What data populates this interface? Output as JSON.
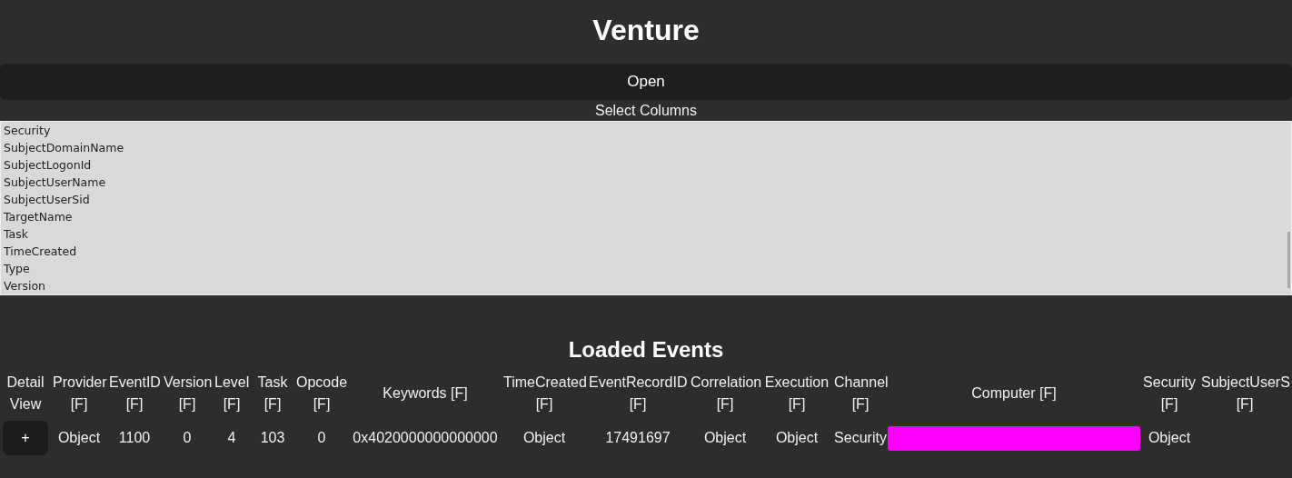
{
  "title": "Venture",
  "open_button": "Open",
  "column_picker": {
    "label": "Select Columns",
    "items": [
      {
        "label": "Security",
        "selected": false
      },
      {
        "label": "SubjectDomainName",
        "selected": false
      },
      {
        "label": "SubjectLogonId",
        "selected": false
      },
      {
        "label": "SubjectUserName",
        "selected": false
      },
      {
        "label": "SubjectUserSid",
        "selected": false
      },
      {
        "label": "TargetName",
        "selected": false
      },
      {
        "label": "Task",
        "selected": false
      },
      {
        "label": "TimeCreated",
        "selected": false
      },
      {
        "label": "Type",
        "selected": false
      },
      {
        "label": "Version",
        "selected": false
      }
    ]
  },
  "events": {
    "title": "Loaded Events",
    "columns": [
      "Detail View",
      "Provider [F]",
      "EventID [F]",
      "Version [F]",
      "Level [F]",
      "Task [F]",
      "Opcode [F]",
      "Keywords [F]",
      "TimeCreated [F]",
      "EventRecordID [F]",
      "Correlation [F]",
      "Execution [F]",
      "Channel [F]",
      "Computer [F]",
      "Security [F]",
      "SubjectUserS [F]"
    ],
    "rows": [
      {
        "cells": [
          {
            "kind": "button",
            "text": "+"
          },
          {
            "kind": "text",
            "text": "Object"
          },
          {
            "kind": "text",
            "text": "1100"
          },
          {
            "kind": "text",
            "text": "0"
          },
          {
            "kind": "text",
            "text": "4"
          },
          {
            "kind": "text",
            "text": "103"
          },
          {
            "kind": "text",
            "text": "0"
          },
          {
            "kind": "text",
            "text": "0x4020000000000000"
          },
          {
            "kind": "text",
            "text": "Object"
          },
          {
            "kind": "text",
            "text": "17491697"
          },
          {
            "kind": "text",
            "text": "Object"
          },
          {
            "kind": "text",
            "text": "Object"
          },
          {
            "kind": "text",
            "text": "Security"
          },
          {
            "kind": "redacted",
            "color": "#ff00ff"
          },
          {
            "kind": "text",
            "text": "Object"
          }
        ]
      }
    ]
  }
}
